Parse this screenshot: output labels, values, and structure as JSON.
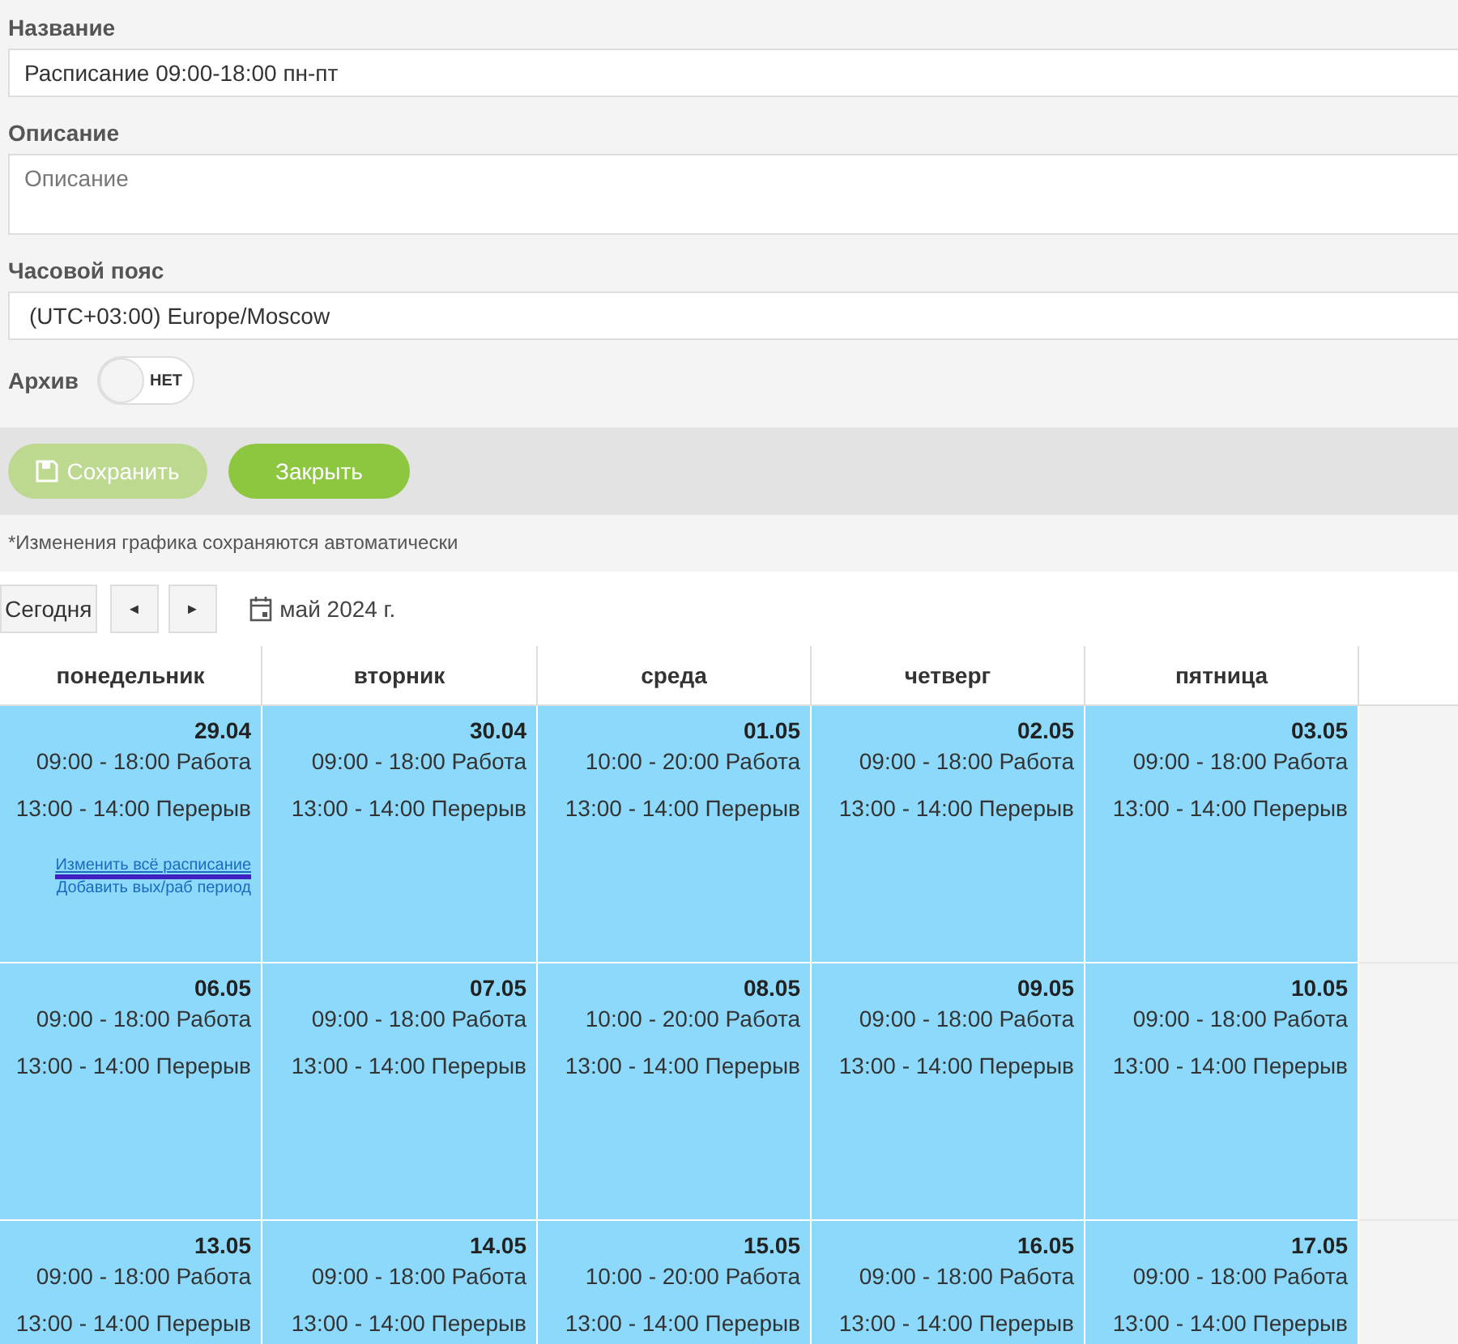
{
  "form": {
    "name_label": "Название",
    "name_value": "Расписание 09:00-18:00 пн-пт",
    "description_label": "Описание",
    "description_placeholder": "Описание",
    "timezone_label": "Часовой пояс",
    "timezone_value": "(UTC+03:00) Europe/Moscow",
    "archive_label": "Архив",
    "archive_on": false,
    "archive_text": "НЕТ"
  },
  "buttons": [
    {
      "label": "Сохранить",
      "kind": "save",
      "disabled": true
    },
    {
      "label": "Закрыть",
      "kind": "close",
      "disabled": false
    }
  ],
  "note": "*Изменения графика сохраняются автоматически",
  "toolbar": {
    "today": "Сегодня",
    "prev": "◄",
    "next": "►",
    "month": "май 2024 г."
  },
  "columns": [
    "понедельник",
    "вторник",
    "среда",
    "четверг",
    "пятница"
  ],
  "weeks": [
    {
      "days": [
        {
          "kind": "work",
          "date": "29.04",
          "work": "09:00 - 18:00 Работа",
          "break": "13:00 - 14:00 Перерыв",
          "links": [
            {
              "label": "Изменить всё расписание",
              "highlighted": true
            },
            {
              "label": "Добавить вых/раб период",
              "highlighted": false
            }
          ]
        },
        {
          "kind": "work",
          "date": "30.04",
          "work": "09:00 - 18:00 Работа",
          "break": "13:00 - 14:00 Перерыв"
        },
        {
          "kind": "work",
          "date": "01.05",
          "work": "10:00 - 20:00 Работа",
          "break": "13:00 - 14:00 Перерыв"
        },
        {
          "kind": "work",
          "date": "02.05",
          "work": "09:00 - 18:00 Работа",
          "break": "13:00 - 14:00 Перерыв"
        },
        {
          "kind": "work",
          "date": "03.05",
          "work": "09:00 - 18:00 Работа",
          "break": "13:00 - 14:00 Перерыв"
        },
        {
          "kind": "off"
        }
      ]
    },
    {
      "days": [
        {
          "kind": "work",
          "date": "06.05",
          "work": "09:00 - 18:00 Работа",
          "break": "13:00 - 14:00 Перерыв"
        },
        {
          "kind": "work",
          "date": "07.05",
          "work": "09:00 - 18:00 Работа",
          "break": "13:00 - 14:00 Перерыв"
        },
        {
          "kind": "work",
          "date": "08.05",
          "work": "10:00 - 20:00 Работа",
          "break": "13:00 - 14:00 Перерыв"
        },
        {
          "kind": "work",
          "date": "09.05",
          "work": "09:00 - 18:00 Работа",
          "break": "13:00 - 14:00 Перерыв"
        },
        {
          "kind": "work",
          "date": "10.05",
          "work": "09:00 - 18:00 Работа",
          "break": "13:00 - 14:00 Перерыв"
        },
        {
          "kind": "off"
        }
      ]
    },
    {
      "days": [
        {
          "kind": "work",
          "date": "13.05",
          "work": "09:00 - 18:00 Работа",
          "break": "13:00 - 14:00 Перерыв"
        },
        {
          "kind": "work",
          "date": "14.05",
          "work": "09:00 - 18:00 Работа",
          "break": "13:00 - 14:00 Перерыв"
        },
        {
          "kind": "work",
          "date": "15.05",
          "work": "10:00 - 20:00 Работа",
          "break": "13:00 - 14:00 Перерыв"
        },
        {
          "kind": "work",
          "date": "16.05",
          "work": "09:00 - 18:00 Работа",
          "break": "13:00 - 14:00 Перерыв"
        },
        {
          "kind": "work",
          "date": "17.05",
          "work": "09:00 - 18:00 Работа",
          "break": "13:00 - 14:00 Перерыв"
        },
        {
          "kind": "off"
        }
      ]
    }
  ]
}
